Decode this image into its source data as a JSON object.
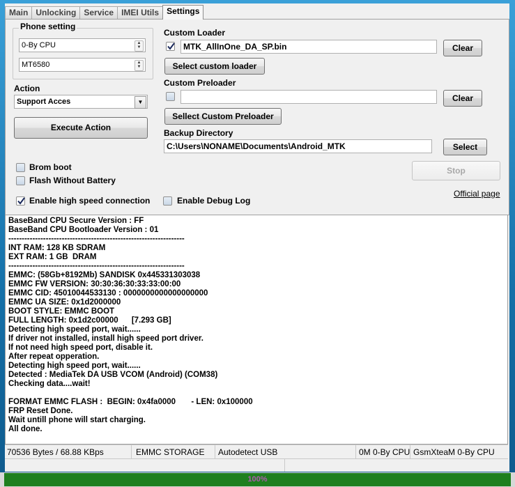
{
  "tabs": [
    "Main",
    "Unlocking",
    "Service",
    "IMEI Utils",
    "Settings"
  ],
  "active_tab": "Settings",
  "phone_setting": {
    "legend": "Phone setting",
    "cpu_combo": "0-By CPU",
    "chip_combo": "MT6580"
  },
  "action": {
    "label": "Action",
    "select_value": "Support Acces",
    "execute_button": "Execute Action"
  },
  "options": {
    "brom_boot": {
      "label": "Brom boot",
      "checked": false
    },
    "flash_without_battery": {
      "label": "Flash Without Battery",
      "checked": false
    },
    "high_speed": {
      "label": "Enable high speed connection",
      "checked": true
    },
    "debug_log": {
      "label": "Enable Debug Log",
      "checked": false
    }
  },
  "custom_loader": {
    "label": "Custom Loader",
    "checked": true,
    "value": "MTK_AllInOne_DA_SP.bin",
    "clear_button": "Clear",
    "select_button": "Select custom loader"
  },
  "custom_preloader": {
    "label": "Custom Preloader",
    "checked": false,
    "value": "",
    "clear_button": "Clear",
    "select_button": "Sellect Custom Preloader"
  },
  "backup_directory": {
    "label": "Backup Directory",
    "value": "C:\\Users\\NONAME\\Documents\\Android_MTK",
    "select_button": "Select"
  },
  "stop_button": "Stop",
  "official_page_link": "Official page",
  "log_lines": [
    "BaseBand CPU Secure Version : FF",
    "BaseBand CPU Bootloader Version : 01",
    "------------------------------------------------------------------",
    "INT RAM: 128 KB SDRAM",
    "EXT RAM: 1 GB  DRAM",
    "------------------------------------------------------------------",
    "EMMC: (58Gb+8192Mb) SANDISK 0x445331303038",
    "EMMC FW VERSION: 30:30:36:30:33:33:00:00",
    "EMMC CID: 45010044533130 : 0000000000000000000",
    "EMMC UA SIZE: 0x1d2000000",
    "BOOT STYLE: EMMC BOOT",
    "FULL LENGTH: 0x1d2c00000      [7.293 GB]",
    "Detecting high speed port, wait......",
    "If driver not installed, install high speed port driver.",
    "If not need high speed port, disable it.",
    "After repeat opperation.",
    "Detecting high speed port, wait......",
    "Detected : MediaTek DA USB VCOM (Android) (COM38)",
    "Checking data....wait!",
    "",
    "FORMAT EMMC FLASH :  BEGIN: 0x4fa0000       - LEN: 0x100000",
    "FRP Reset Done.",
    "Wait untill phone will start charging.",
    "All done."
  ],
  "status_bar": {
    "transfer": "70536 Bytes / 68.88 KBps",
    "storage": "EMMC STORAGE",
    "port": "Autodetect USB",
    "memory": "0M 0-By CPU",
    "product": "GsmXteaM 0-By CPU"
  },
  "progress": {
    "percent": 100,
    "text": "100%",
    "color": "#1e7f1e"
  }
}
